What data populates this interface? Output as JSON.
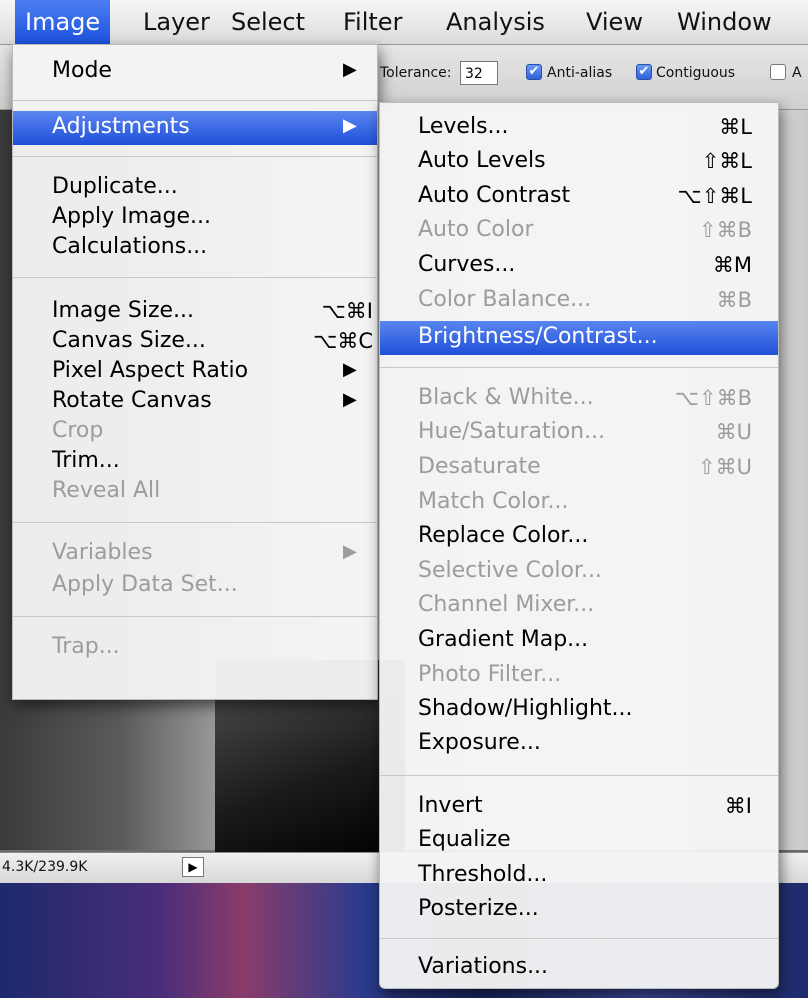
{
  "menubar": {
    "items": [
      {
        "label": "Image"
      },
      {
        "label": "Layer"
      },
      {
        "label": "Select"
      },
      {
        "label": "Filter"
      },
      {
        "label": "Analysis"
      },
      {
        "label": "View"
      },
      {
        "label": "Window"
      }
    ]
  },
  "options_bar": {
    "tolerance_label": "Tolerance:",
    "tolerance_value": "32",
    "anti_alias_label": "Anti-alias",
    "contiguous_label": "Contiguous",
    "check_mark": "✔",
    "truncated_label": "A"
  },
  "status_bar": {
    "doc_size": "4.3K/239.9K",
    "arrow": "▶"
  },
  "image_menu": {
    "items": [
      {
        "label": "Mode",
        "shortcut": "",
        "submenu": true,
        "disabled": false
      },
      {
        "label": "Adjustments",
        "shortcut": "",
        "submenu": true,
        "disabled": false,
        "highlighted": true
      },
      {
        "label": "Duplicate...",
        "shortcut": "",
        "submenu": false,
        "disabled": false
      },
      {
        "label": "Apply Image...",
        "shortcut": "",
        "submenu": false,
        "disabled": false
      },
      {
        "label": "Calculations...",
        "shortcut": "",
        "submenu": false,
        "disabled": false
      },
      {
        "label": "Image Size...",
        "shortcut": "⌥⌘I",
        "submenu": false,
        "disabled": false
      },
      {
        "label": "Canvas Size...",
        "shortcut": "⌥⌘C",
        "submenu": false,
        "disabled": false
      },
      {
        "label": "Pixel Aspect Ratio",
        "shortcut": "",
        "submenu": true,
        "disabled": false
      },
      {
        "label": "Rotate Canvas",
        "shortcut": "",
        "submenu": true,
        "disabled": false
      },
      {
        "label": "Crop",
        "shortcut": "",
        "submenu": false,
        "disabled": true
      },
      {
        "label": "Trim...",
        "shortcut": "",
        "submenu": false,
        "disabled": false
      },
      {
        "label": "Reveal All",
        "shortcut": "",
        "submenu": false,
        "disabled": true
      },
      {
        "label": "Variables",
        "shortcut": "",
        "submenu": true,
        "disabled": true
      },
      {
        "label": "Apply Data Set...",
        "shortcut": "",
        "submenu": false,
        "disabled": true
      },
      {
        "label": "Trap...",
        "shortcut": "",
        "submenu": false,
        "disabled": true
      }
    ],
    "submenu_arrow": "▶"
  },
  "adjustments_menu": {
    "items": [
      {
        "label": "Levels...",
        "shortcut": "⌘L",
        "disabled": false
      },
      {
        "label": "Auto Levels",
        "shortcut": "⇧⌘L",
        "disabled": false
      },
      {
        "label": "Auto Contrast",
        "shortcut": "⌥⇧⌘L",
        "disabled": false
      },
      {
        "label": "Auto Color",
        "shortcut": "⇧⌘B",
        "disabled": true
      },
      {
        "label": "Curves...",
        "shortcut": "⌘M",
        "disabled": false
      },
      {
        "label": "Color Balance...",
        "shortcut": "⌘B",
        "disabled": true
      },
      {
        "label": "Brightness/Contrast...",
        "shortcut": "",
        "disabled": false,
        "highlighted": true
      },
      {
        "label": "Black & White...",
        "shortcut": "⌥⇧⌘B",
        "disabled": true
      },
      {
        "label": "Hue/Saturation...",
        "shortcut": "⌘U",
        "disabled": true
      },
      {
        "label": "Desaturate",
        "shortcut": "⇧⌘U",
        "disabled": true
      },
      {
        "label": "Match Color...",
        "shortcut": "",
        "disabled": true
      },
      {
        "label": "Replace Color...",
        "shortcut": "",
        "disabled": false
      },
      {
        "label": "Selective Color...",
        "shortcut": "",
        "disabled": true
      },
      {
        "label": "Channel Mixer...",
        "shortcut": "",
        "disabled": true
      },
      {
        "label": "Gradient Map...",
        "shortcut": "",
        "disabled": false
      },
      {
        "label": "Photo Filter...",
        "shortcut": "",
        "disabled": true
      },
      {
        "label": "Shadow/Highlight...",
        "shortcut": "",
        "disabled": false
      },
      {
        "label": "Exposure...",
        "shortcut": "",
        "disabled": false
      },
      {
        "label": "Invert",
        "shortcut": "⌘I",
        "disabled": false
      },
      {
        "label": "Equalize",
        "shortcut": "",
        "disabled": false
      },
      {
        "label": "Threshold...",
        "shortcut": "",
        "disabled": false
      },
      {
        "label": "Posterize...",
        "shortcut": "",
        "disabled": false
      },
      {
        "label": "Variations...",
        "shortcut": "",
        "disabled": false
      }
    ]
  },
  "colors": {
    "highlight": "#1f4fd9",
    "disabled_text": "#9c9c9c"
  }
}
